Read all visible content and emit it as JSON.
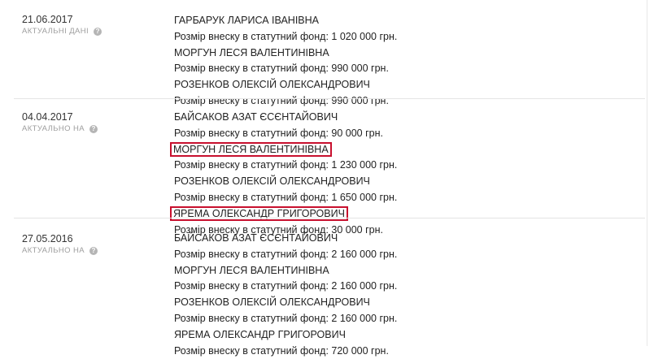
{
  "records": [
    {
      "date": "21.06.2017",
      "status": "АКТУАЛЬНІ ДАНІ",
      "lines": [
        "ГАРБАРУК ЛАРИСА ІВАНІВНА",
        "Розмір внеску в статутний фонд: 1 020 000 грн.",
        "МОРГУН ЛЕСЯ ВАЛЕНТИНІВНА",
        "Розмір внеску в статутний фонд: 990 000 грн.",
        "РОЗЕНКОВ ОЛЕКСІЙ ОЛЕКСАНДРОВИЧ",
        "Розмір внеску в статутний фонд: 990 000 грн."
      ]
    },
    {
      "date": "04.04.2017",
      "status": "АКТУАЛЬНО НА",
      "lines": [
        "БАЙСАКОВ АЗАТ ЄСЄНТАЙОВИЧ",
        "Розмір внеску в статутний фонд: 90 000 грн.",
        "МОРГУН ЛЕСЯ ВАЛЕНТИНІВНА",
        "Розмір внеску в статутний фонд: 1 230 000 грн.",
        "РОЗЕНКОВ ОЛЕКСІЙ ОЛЕКСАНДРОВИЧ",
        "Розмір внеску в статутний фонд: 1 650 000 грн.",
        "ЯРЕМА ОЛЕКСАНДР ГРИГОРОВИЧ",
        "Розмір внеску в статутний фонд: 30 000 грн."
      ]
    },
    {
      "date": "27.05.2016",
      "status": "АКТУАЛЬНО НА",
      "lines": [
        "БАЙСАКОВ АЗАТ ЄСЄНТАЙОВИЧ",
        "Розмір внеску в статутний фонд: 2 160 000 грн.",
        "МОРГУН ЛЕСЯ ВАЛЕНТИНІВНА",
        "Розмір внеску в статутний фонд: 2 160 000 грн.",
        "РОЗЕНКОВ ОЛЕКСІЙ ОЛЕКСАНДРОВИЧ",
        "Розмір внеску в статутний фонд: 2 160 000 грн.",
        "ЯРЕМА ОЛЕКСАНДР ГРИГОРОВИЧ",
        "Розмір внеску в статутний фонд: 720 000 грн."
      ]
    }
  ],
  "help_icon": "question-circle-icon",
  "help_glyph": "?",
  "highlight_color": "#c8102e"
}
